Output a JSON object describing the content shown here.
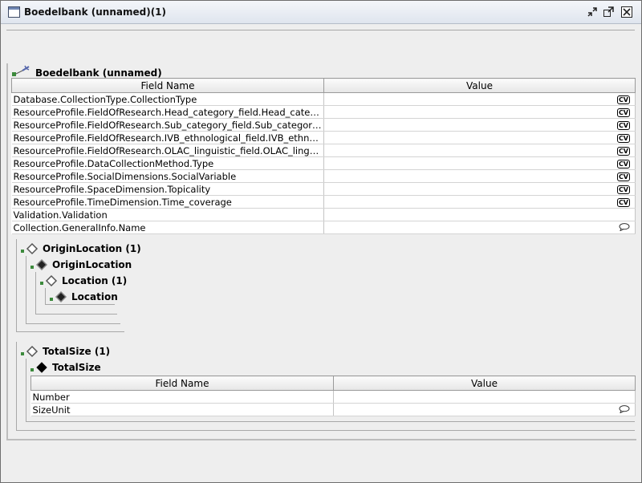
{
  "window": {
    "title": "Boedelbank (unnamed)(1)"
  },
  "root": {
    "label": "Boedelbank (unnamed)"
  },
  "main_table": {
    "columns": [
      "Field Name",
      "Value"
    ],
    "rows": [
      {
        "field": "Database.CollectionType.CollectionType",
        "value_icon": "cv"
      },
      {
        "field": "ResourceProfile.FieldOfResearch.Head_category_field.Head_categ...",
        "value_icon": "cv"
      },
      {
        "field": "ResourceProfile.FieldOfResearch.Sub_category_field.Sub_category...",
        "value_icon": "cv"
      },
      {
        "field": "ResourceProfile.FieldOfResearch.IVB_ethnological_field.IVB_ethnol...",
        "value_icon": "cv"
      },
      {
        "field": "ResourceProfile.FieldOfResearch.OLAC_linguistic_field.OLAC_lingu...",
        "value_icon": "cv"
      },
      {
        "field": "ResourceProfile.DataCollectionMethod.Type",
        "value_icon": "cv"
      },
      {
        "field": "ResourceProfile.SocialDimensions.SocialVariable",
        "value_icon": "cv"
      },
      {
        "field": "ResourceProfile.SpaceDimension.Topicality",
        "value_icon": "cv"
      },
      {
        "field": "ResourceProfile.TimeDimension.Time_coverage",
        "value_icon": "cv"
      },
      {
        "field": "Validation.Validation",
        "value_icon": ""
      },
      {
        "field": "Collection.GeneralInfo.Name",
        "value_icon": "speech"
      }
    ]
  },
  "cv_label": "CV",
  "origin_tree": {
    "group": "OriginLocation (1)",
    "item": "OriginLocation",
    "sub_group": "Location (1)",
    "sub_item": "Location"
  },
  "size_tree": {
    "group": "TotalSize (1)",
    "item": "TotalSize"
  },
  "size_table": {
    "columns": [
      "Field Name",
      "Value"
    ],
    "rows": [
      {
        "field": "Number",
        "value_icon": ""
      },
      {
        "field": "SizeUnit",
        "value_icon": "speech"
      }
    ]
  },
  "icons": {
    "window": "window-icon",
    "minimize": "minimize-icon",
    "maximize": "maximize-icon",
    "close": "close-icon",
    "root": "component-tree-icon",
    "group": "hollow-diamond-icon",
    "item": "filled-diamond-icon",
    "cv": "controlled-vocabulary-icon",
    "speech": "speech-bubble-icon"
  }
}
